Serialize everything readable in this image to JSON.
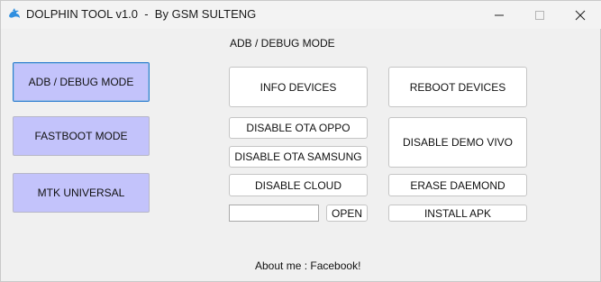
{
  "window": {
    "title": "DOLPHIN TOOL v1.0  -  By GSM SULTENG",
    "controls": [
      "minimize",
      "maximize",
      "close"
    ]
  },
  "sidebar": {
    "items": [
      {
        "label": "ADB / DEBUG MODE",
        "active": true
      },
      {
        "label": "FASTBOOT MODE",
        "active": false
      },
      {
        "label": "MTK UNIVERSAL",
        "active": false
      }
    ]
  },
  "main": {
    "section_title": "ADB / DEBUG MODE",
    "buttons": {
      "info_devices": "INFO DEVICES",
      "reboot_devices": "REBOOT DEVICES",
      "disable_ota_oppo": "DISABLE OTA OPPO",
      "disable_ota_samsung": "DISABLE OTA SAMSUNG",
      "disable_demo_vivo": "DISABLE DEMO VIVO",
      "disable_cloud": "DISABLE CLOUD",
      "erase_daemond": "ERASE DAEMOND",
      "open": "OPEN",
      "install_apk": "INSTALL APK"
    },
    "apk_path": {
      "value": "",
      "placeholder": ""
    }
  },
  "footer": {
    "about": "About me : Facebook!"
  },
  "colors": {
    "window_bg": "#f0f0f0",
    "sidebar_button_bg": "#c3c3fb",
    "active_border": "#2b7bd0",
    "icon_blue": "#2f8fe0"
  },
  "icons": {
    "app": "dolphin-icon",
    "minimize": "minimize-icon",
    "maximize": "maximize-icon",
    "close": "close-icon"
  }
}
